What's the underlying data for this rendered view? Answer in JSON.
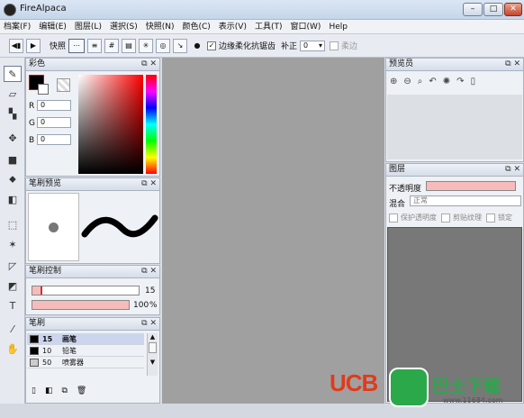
{
  "window": {
    "title": "FireAlpaca",
    "min": "–",
    "max": "□",
    "close": "✕"
  },
  "menu": [
    "档案(F)",
    "编辑(E)",
    "图层(L)",
    "選択(S)",
    "快照(N)",
    "颜色(C)",
    "表示(V)",
    "工具(T)",
    "窗口(W)",
    "Help"
  ],
  "toolbar": {
    "prev": "◀▮",
    "next": "▶",
    "snap_label": "快照",
    "antialias_label": "边缘柔化抗锯齿",
    "correction_label": "补正",
    "correction_value": "0",
    "soft_label": "柔边"
  },
  "color_panel": {
    "title": "彩色",
    "r_label": "R",
    "r": "0",
    "g_label": "G",
    "g": "0",
    "b_label": "B",
    "b": "0"
  },
  "brush_preview": {
    "title": "笔刷预览"
  },
  "brush_control": {
    "title": "笔刷控制",
    "size": "15",
    "opacity": "100",
    "opacity_unit": "%"
  },
  "brush_list": {
    "title": "笔刷",
    "items": [
      {
        "size": "15",
        "name": "画笔"
      },
      {
        "size": "10",
        "name": "铅笔"
      },
      {
        "size": "50",
        "name": "喷雾器"
      }
    ]
  },
  "navigator": {
    "title": "预览员"
  },
  "layers": {
    "title": "图层",
    "opacity_label": "不透明度",
    "blend_label": "混合",
    "blend_value": "正常",
    "protect_label": "保护透明度",
    "clip_label": "剪贴纹理",
    "lock_label": "锁定"
  },
  "watermark": {
    "left": "UCB",
    "right": "巴士下载",
    "url": "www.11684.com"
  },
  "colors": {
    "accent": "#f6bcbc",
    "canvas": "#a0a0a0"
  }
}
